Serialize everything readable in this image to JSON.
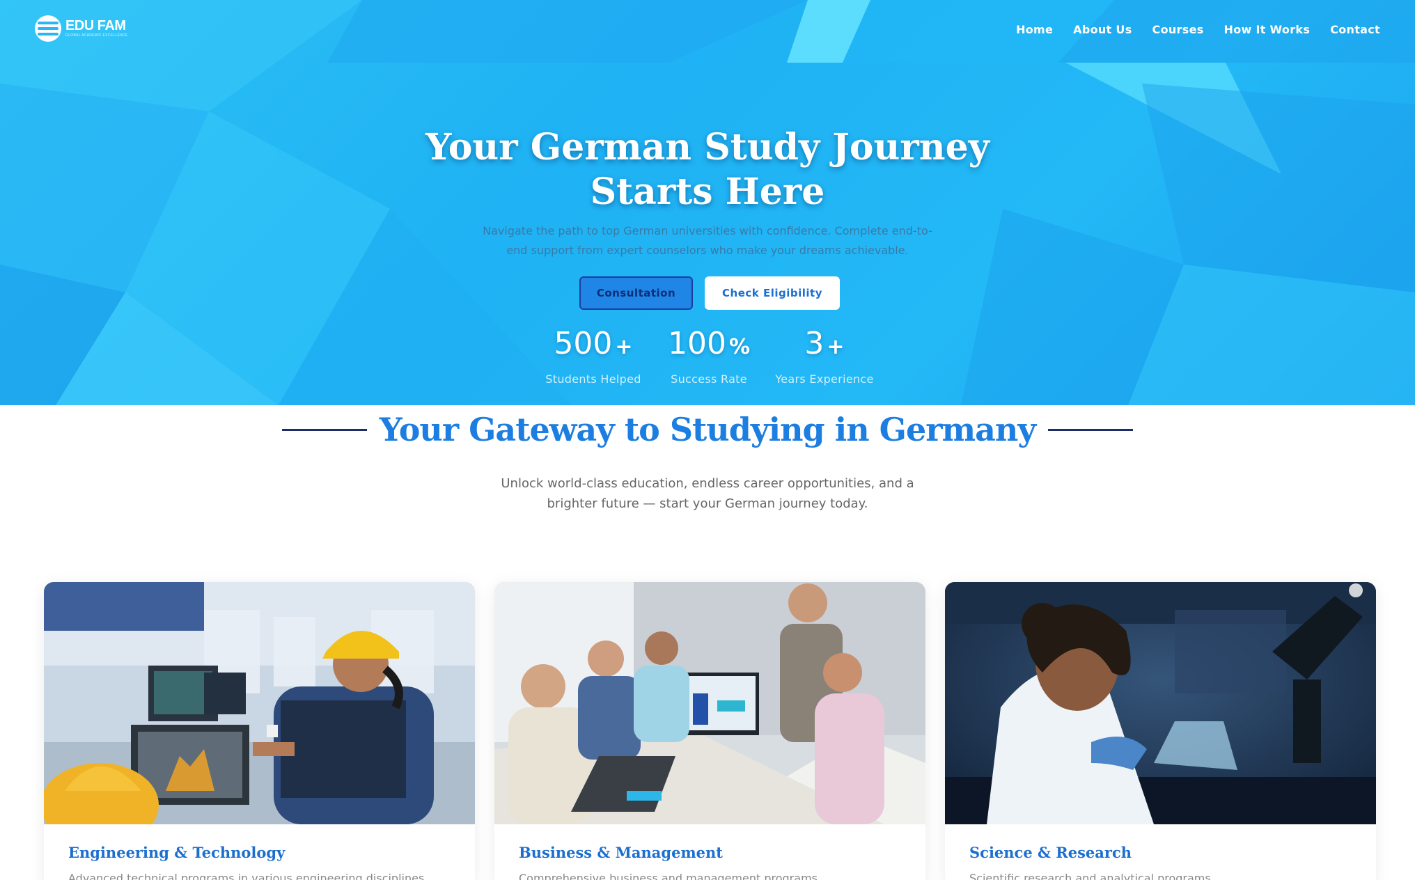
{
  "nav": {
    "logo_name": "EDU FAM",
    "logo_tagline": "GLOBAL ACADEMIC EXCELLENCE",
    "links": [
      "Home",
      "About Us",
      "Courses",
      "How It Works",
      "Contact"
    ]
  },
  "hero": {
    "title_line1": "Your German Study Journey",
    "title_line2": "Starts Here",
    "subtitle": "Navigate the path to top German universities with confidence. Complete end-to-end support from expert counselors who make your dreams achievable.",
    "consult_label": "Consultation",
    "check_label": "Check Eligibility",
    "stats": [
      {
        "value": "500",
        "suffix": "+",
        "label": "Students Helped"
      },
      {
        "value": "100",
        "suffix": "%",
        "label": "Success Rate"
      },
      {
        "value": "3",
        "suffix": "+",
        "label": "Years Experience"
      }
    ]
  },
  "gateway": {
    "title": "Your Gateway to Studying in Germany",
    "subtitle": "Unlock world-class education, endless career opportunities, and a brighter future — start your German journey today."
  },
  "cards": [
    {
      "title": "Engineering & Technology",
      "desc": "Advanced technical programs in various engineering disciplines"
    },
    {
      "title": "Business & Management",
      "desc": "Comprehensive business and management programs"
    },
    {
      "title": "Science & Research",
      "desc": "Scientific research and analytical programs"
    }
  ],
  "colors": {
    "hero_blue": "#1fb2f4",
    "accent_blue": "#1c7ee0",
    "navy": "#1a2e6a"
  }
}
